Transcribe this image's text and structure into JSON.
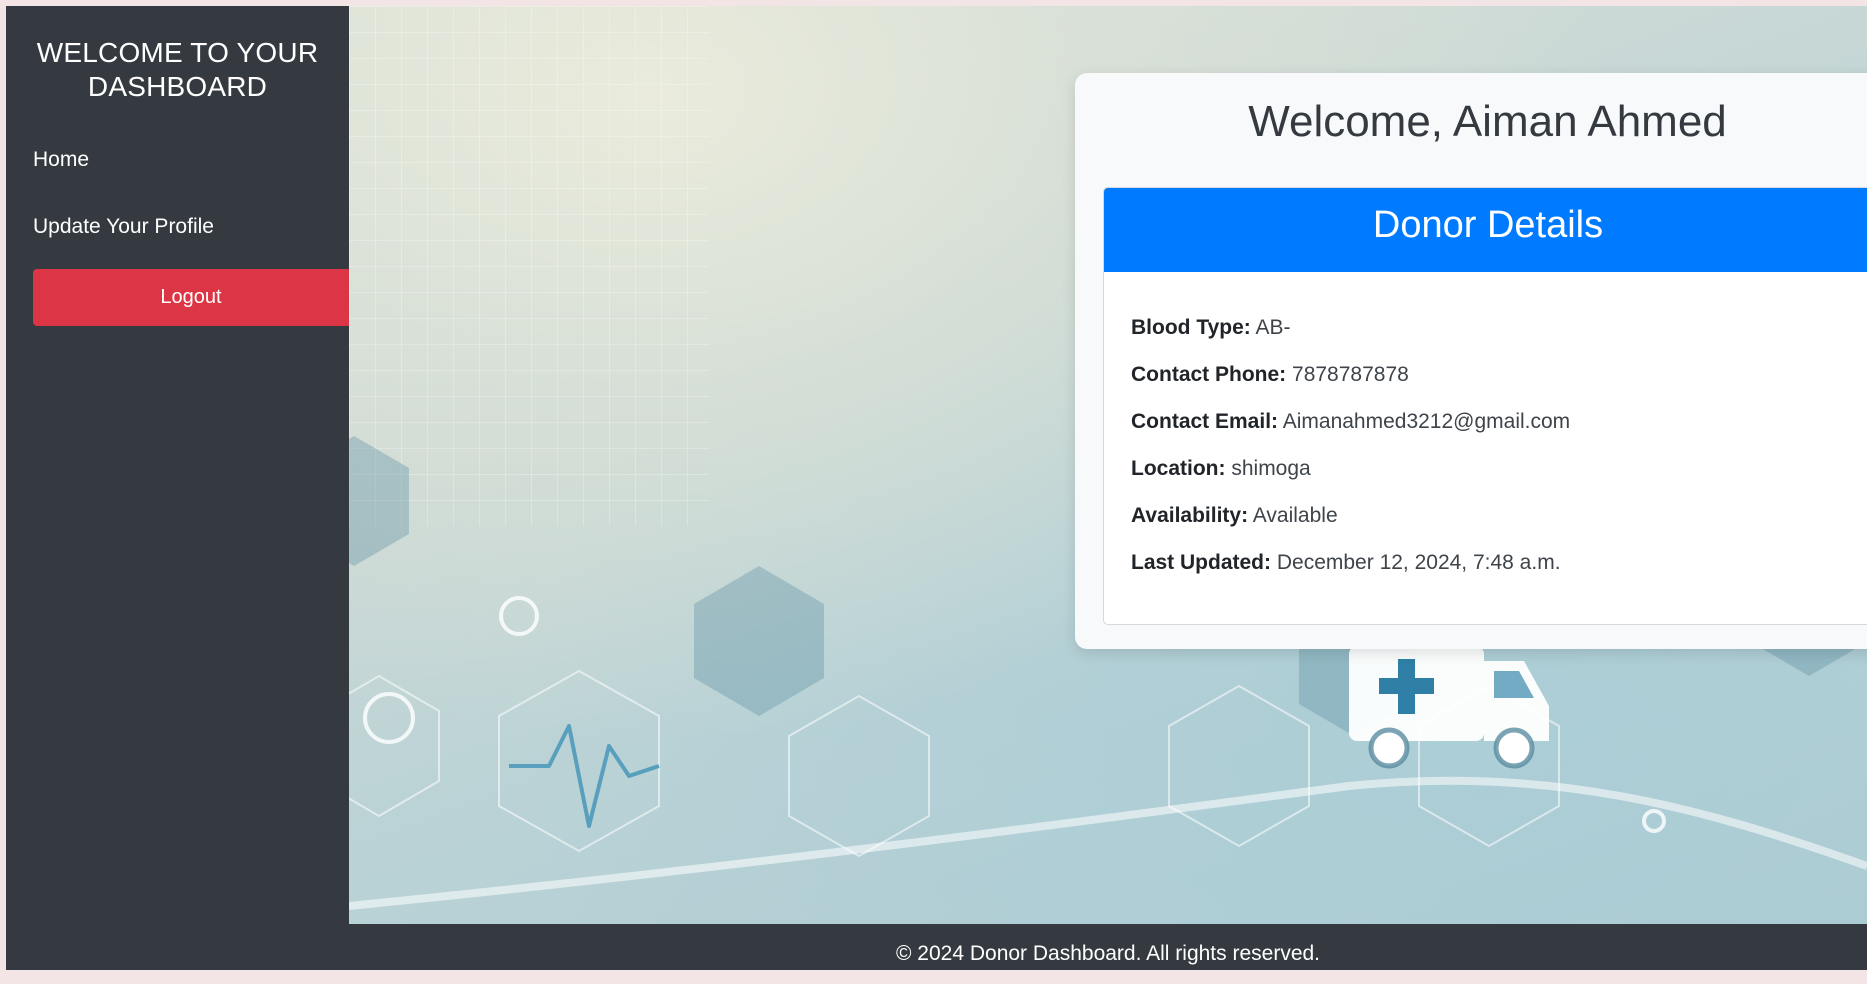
{
  "sidebar": {
    "title": "WELCOME TO YOUR DASHBOARD",
    "nav": {
      "home": "Home",
      "update_profile": "Update Your Profile"
    },
    "logout_label": "Logout"
  },
  "main": {
    "welcome_text": "Welcome, Aiman Ahmed",
    "donor_card": {
      "header": "Donor Details",
      "fields": [
        {
          "label": "Blood Type:",
          "value": "AB-"
        },
        {
          "label": "Contact Phone:",
          "value": "7878787878"
        },
        {
          "label": "Contact Email:",
          "value": "Aimanahmed3212@gmail.com"
        },
        {
          "label": "Location:",
          "value": "shimoga"
        },
        {
          "label": "Availability:",
          "value": "Available"
        },
        {
          "label": "Last Updated:",
          "value": "December 12, 2024, 7:48 a.m."
        }
      ]
    }
  },
  "footer": {
    "text": "© 2024 Donor Dashboard. All rights reserved."
  },
  "colors": {
    "sidebar_bg": "#343a40",
    "logout_bg": "#dc3545",
    "card_header_bg": "#007bff",
    "card_bg": "#f8f9fa"
  },
  "icons": [
    "heartbeat-icon",
    "caduceus-icon",
    "ambulance-icon",
    "hexagon-pattern"
  ]
}
